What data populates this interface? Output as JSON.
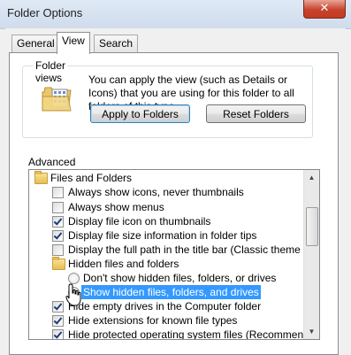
{
  "window": {
    "title": "Folder Options",
    "close_glyph": "✕"
  },
  "tabs": [
    {
      "label": "General"
    },
    {
      "label": "View"
    },
    {
      "label": "Search"
    }
  ],
  "folder_views": {
    "group_label": "Folder views",
    "icon": "folder-views-icon",
    "description": "You can apply the view (such as Details or Icons) that you are using for this folder to all folders of this type.",
    "apply_button": "Apply to Folders",
    "reset_button": "Reset Folders"
  },
  "advanced": {
    "label": "Advanced settings:",
    "items": [
      {
        "type": "folder",
        "label": "Files and Folders"
      },
      {
        "type": "checkbox",
        "checked": false,
        "label": "Always show icons, never thumbnails"
      },
      {
        "type": "checkbox",
        "checked": false,
        "label": "Always show menus"
      },
      {
        "type": "checkbox",
        "checked": true,
        "label": "Display file icon on thumbnails"
      },
      {
        "type": "checkbox",
        "checked": true,
        "label": "Display file size information in folder tips"
      },
      {
        "type": "checkbox",
        "checked": false,
        "label": "Display the full path in the title bar (Classic theme only)"
      },
      {
        "type": "folder",
        "label": "Hidden files and folders"
      },
      {
        "type": "radio",
        "checked": false,
        "label": "Don't show hidden files, folders, or drives"
      },
      {
        "type": "radio",
        "checked": true,
        "selected": true,
        "label": "Show hidden files, folders, and drives"
      },
      {
        "type": "checkbox",
        "checked": true,
        "label": "Hide empty drives in the Computer folder"
      },
      {
        "type": "checkbox",
        "checked": true,
        "label": "Hide extensions for known file types"
      },
      {
        "type": "checkbox",
        "checked": true,
        "label": "Hide protected operating system files (Recommended)"
      }
    ]
  }
}
